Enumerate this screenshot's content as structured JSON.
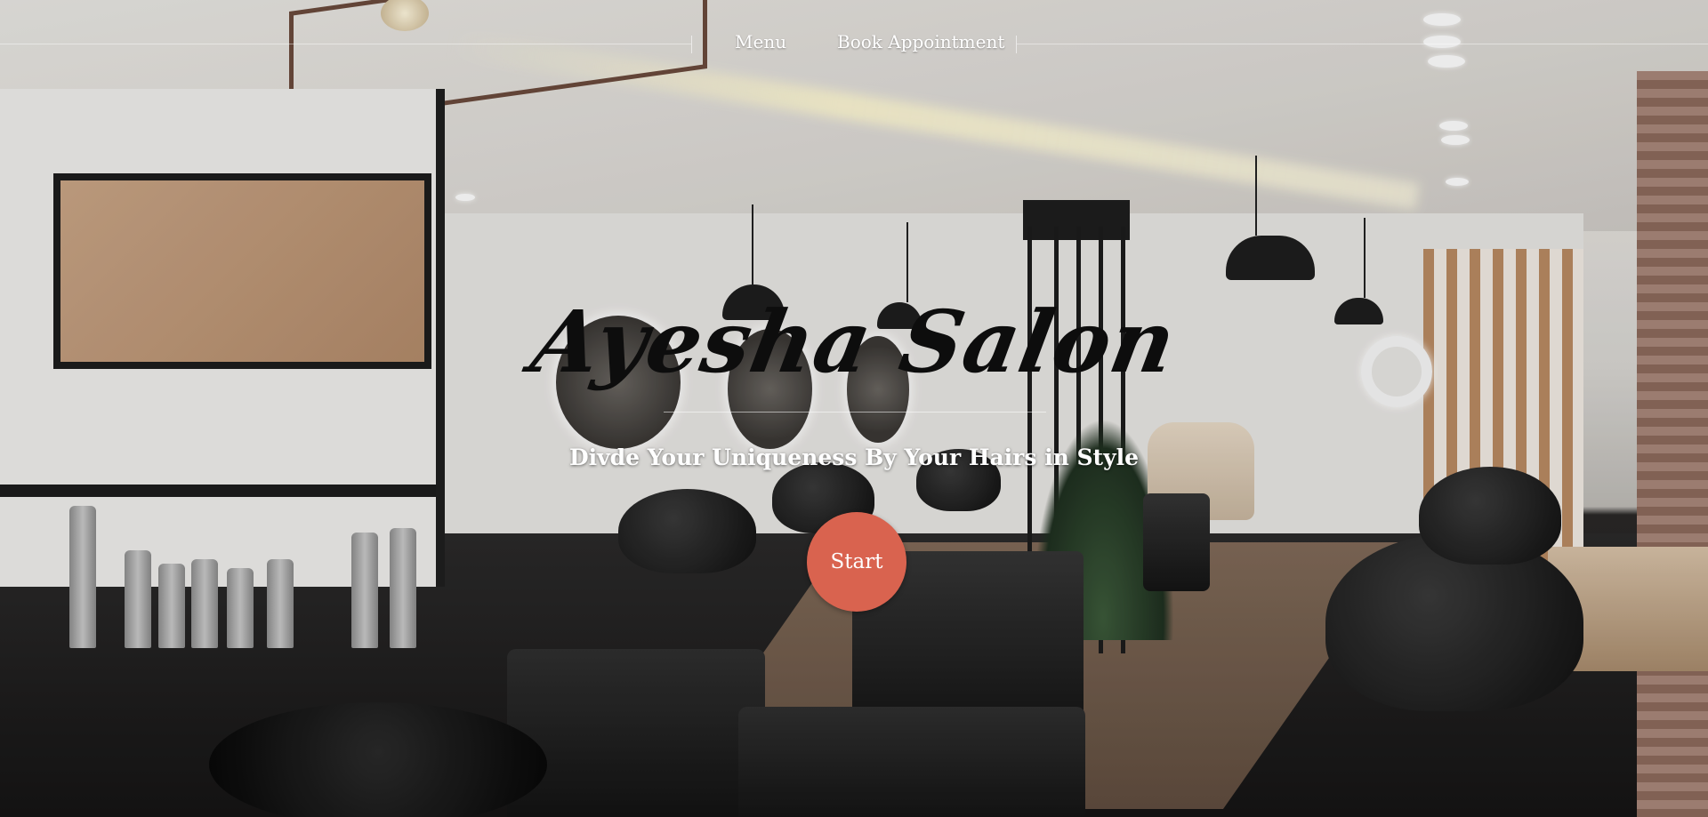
{
  "nav": {
    "items": [
      {
        "label": "Menu"
      },
      {
        "label": "Book Appointment"
      }
    ]
  },
  "hero": {
    "title": "Ayesha Salon",
    "subtitle": "Divde Your Uniqueness By Your Hairs in Style",
    "cta_label": "Start"
  },
  "colors": {
    "cta_background": "#d9634f",
    "title_text": "#0d0d0d",
    "nav_text": "#ffffff"
  },
  "background": {
    "icon": "salon-interior-photo"
  }
}
